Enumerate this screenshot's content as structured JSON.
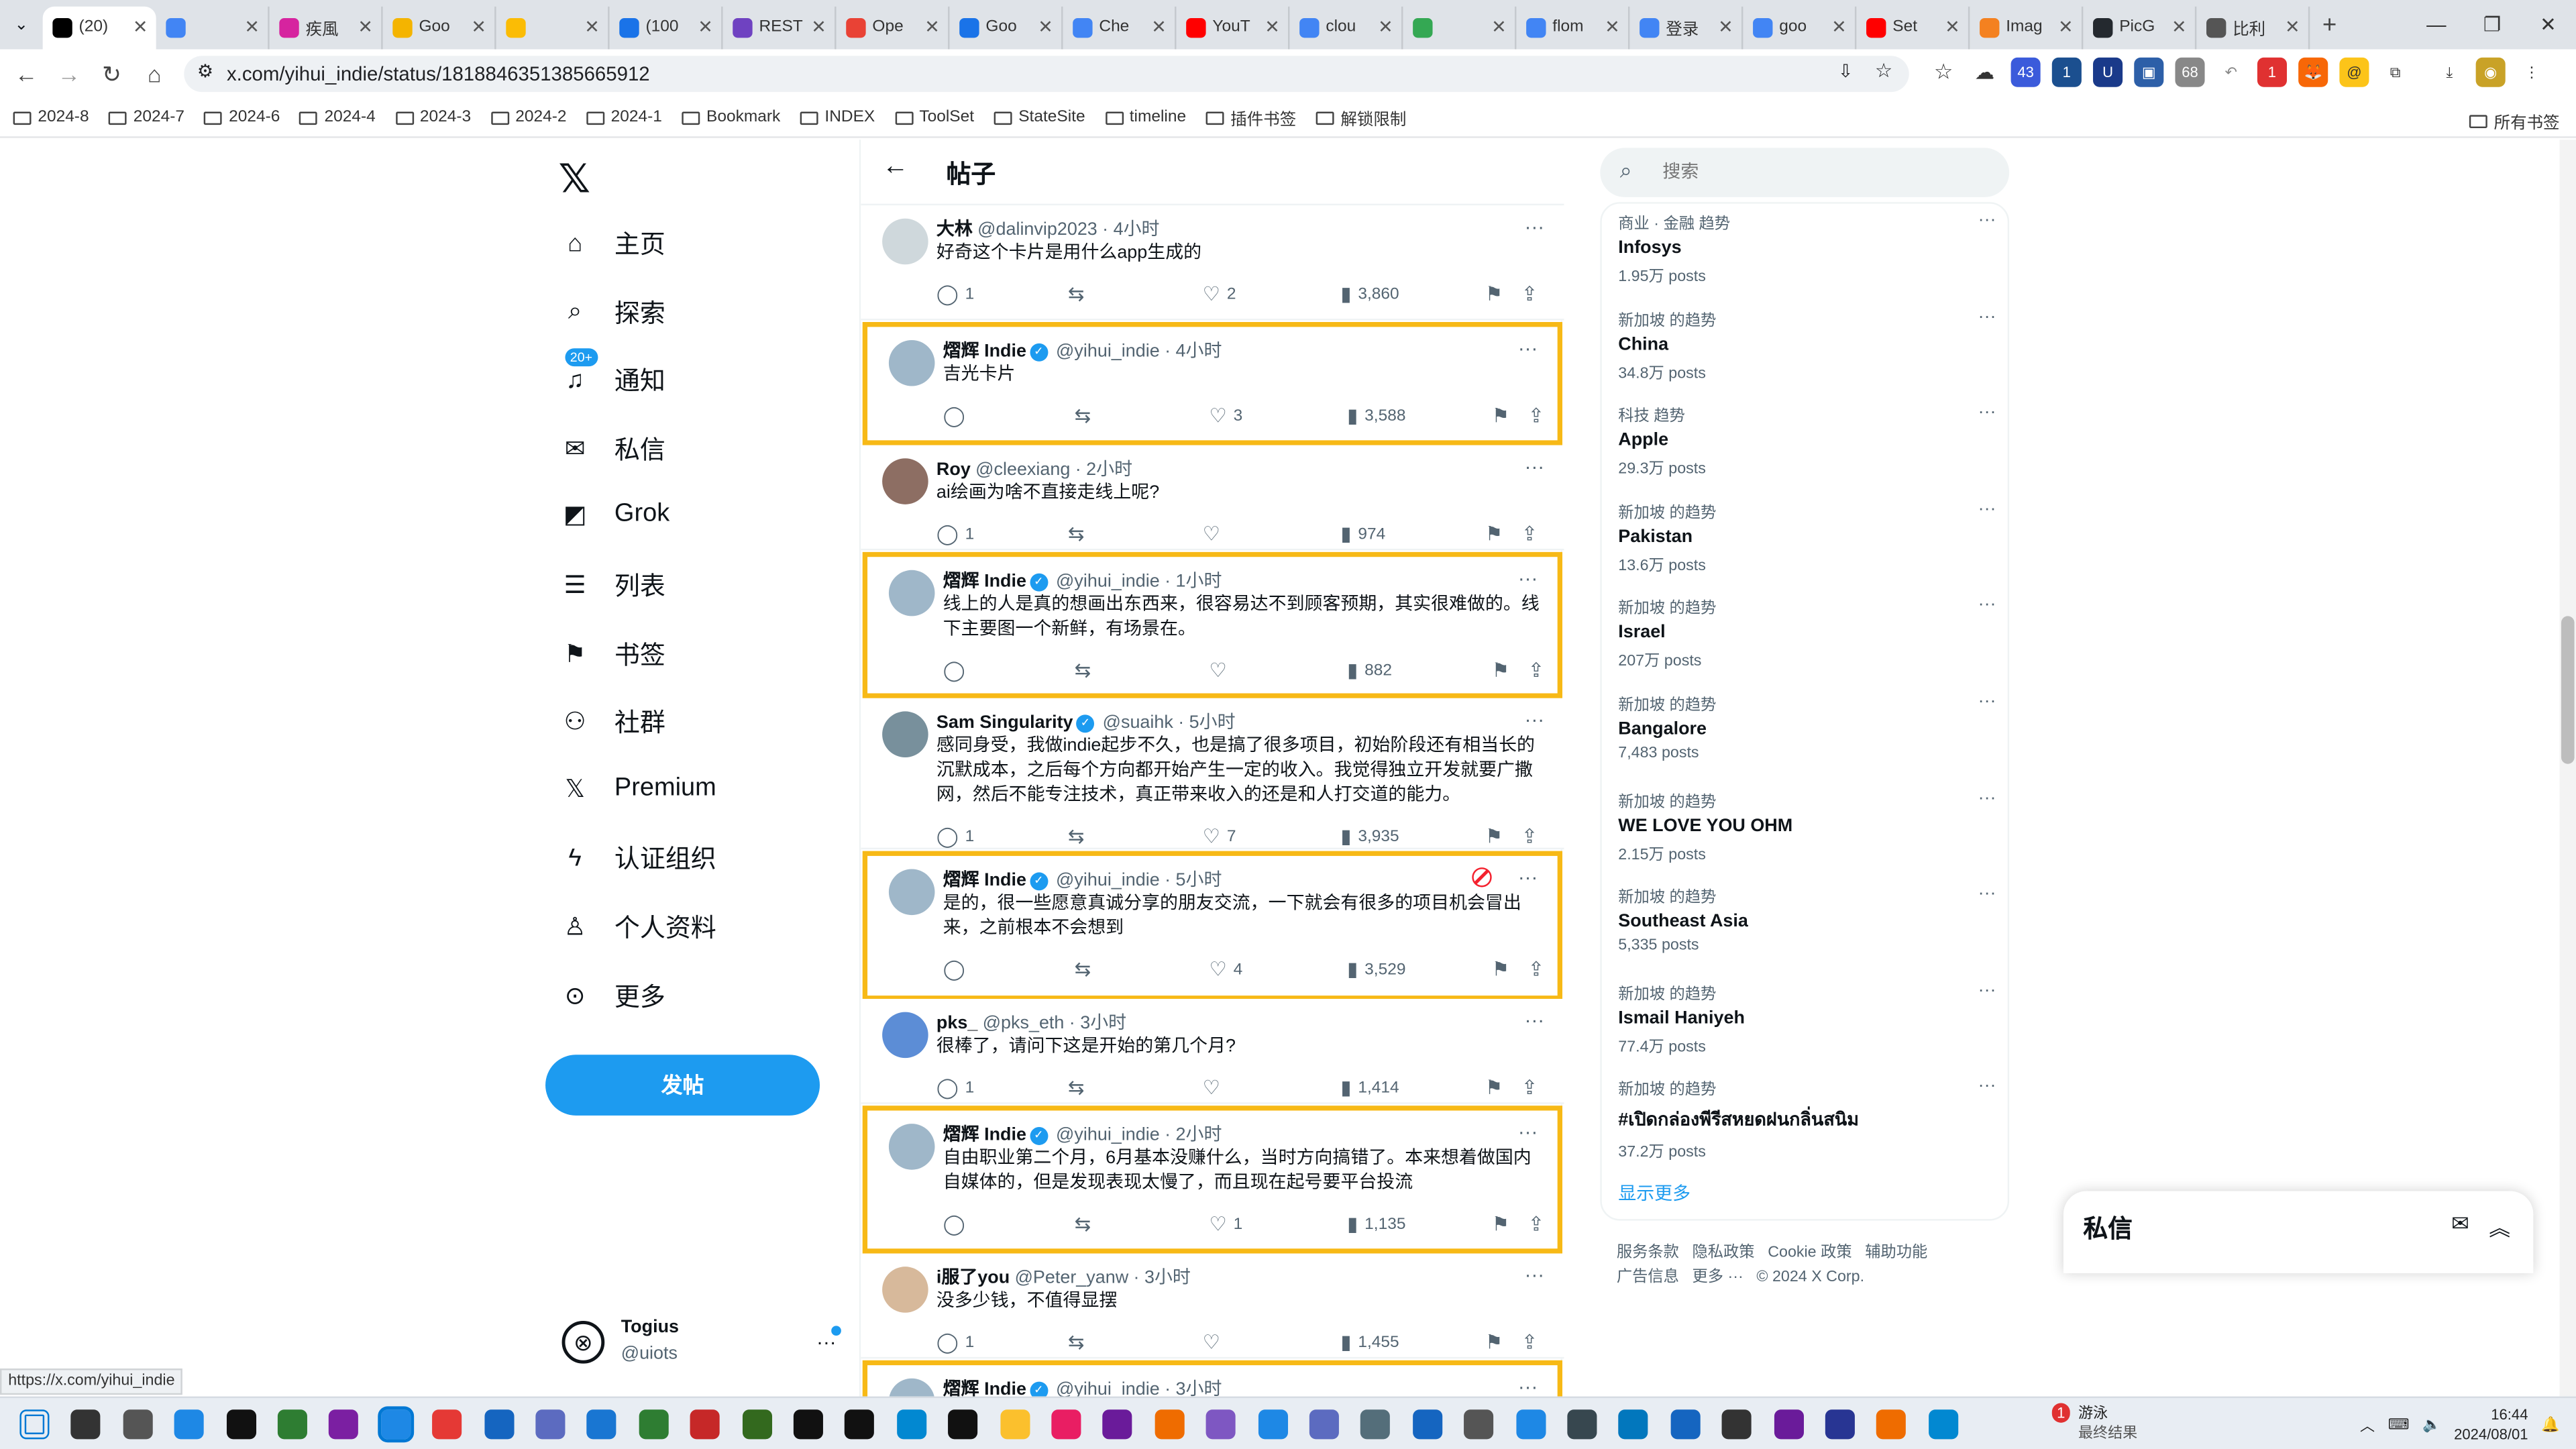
{
  "browser": {
    "tabs": [
      {
        "label": "(20)",
        "color": "#000000",
        "active": true
      },
      {
        "label": "",
        "color": "#4285f4"
      },
      {
        "label": "疾風",
        "color": "#d6249f"
      },
      {
        "label": "Goo",
        "color": "#f4b400"
      },
      {
        "label": "",
        "color": "#fbbc05"
      },
      {
        "label": "(100",
        "color": "#1a73e8"
      },
      {
        "label": "REST",
        "color": "#6f42c1"
      },
      {
        "label": "Ope",
        "color": "#e94235"
      },
      {
        "label": "Goo",
        "color": "#1a73e8"
      },
      {
        "label": "Che",
        "color": "#4285f4"
      },
      {
        "label": "YouT",
        "color": "#ff0000"
      },
      {
        "label": "clou",
        "color": "#4285f4"
      },
      {
        "label": "",
        "color": "#34a853"
      },
      {
        "label": "flom",
        "color": "#4285f4"
      },
      {
        "label": "登录",
        "color": "#4285f4"
      },
      {
        "label": "goo",
        "color": "#4285f4"
      },
      {
        "label": "Set",
        "color": "#ff0000"
      },
      {
        "label": "Imag",
        "color": "#f48120"
      },
      {
        "label": "PicG",
        "color": "#24292f"
      },
      {
        "label": "比利",
        "color": "#555555"
      }
    ],
    "url": "x.com/yihui_indie/status/1818846351385665912",
    "bookmarks": [
      "2024-8",
      "2024-7",
      "2024-6",
      "2024-4",
      "2024-3",
      "2024-2",
      "2024-1",
      "Bookmark",
      "INDEX",
      "ToolSet",
      "StateSite",
      "timeline",
      "插件书签",
      "解锁限制"
    ],
    "all_bookmarks": "所有书签",
    "ext_badges": {
      "a": "43",
      "b": "1",
      "c": "68",
      "d": "1"
    },
    "status_url": "https://x.com/yihui_indie"
  },
  "nav": {
    "items": [
      {
        "label": "主页",
        "icon": "home-icon"
      },
      {
        "label": "探索",
        "icon": "search-icon"
      },
      {
        "label": "通知",
        "icon": "bell-icon",
        "badge": "20+"
      },
      {
        "label": "私信",
        "icon": "mail-icon"
      },
      {
        "label": "Grok",
        "icon": "grok-icon"
      },
      {
        "label": "列表",
        "icon": "list-icon"
      },
      {
        "label": "书签",
        "icon": "bookmark-icon"
      },
      {
        "label": "社群",
        "icon": "people-icon"
      },
      {
        "label": "Premium",
        "icon": "x-icon"
      },
      {
        "label": "认证组织",
        "icon": "bolt-icon"
      },
      {
        "label": "个人资料",
        "icon": "person-icon"
      },
      {
        "label": "更多",
        "icon": "more-circle-icon"
      }
    ],
    "post_button": "发帖",
    "account": {
      "name": "Togius",
      "handle": "@uiots"
    }
  },
  "main": {
    "title": "帖子",
    "tweets": [
      {
        "name": "大林",
        "handle": "@dalinvip2023",
        "time": "· 4小时",
        "text": "好奇这个卡片是用什么app生成的",
        "replies": "1",
        "retweets": "",
        "likes": "2",
        "views": "3,860",
        "verified": false,
        "highlight": false
      },
      {
        "name": "熠辉 Indie",
        "handle": "@yihui_indie",
        "time": "· 4小时",
        "text": "吉光卡片",
        "replies": "",
        "retweets": "",
        "likes": "3",
        "views": "3,588",
        "verified": true,
        "highlight": true
      },
      {
        "name": "Roy",
        "handle": "@cleexiang",
        "time": "· 2小时",
        "text": "ai绘画为啥不直接走线上呢?",
        "replies": "1",
        "retweets": "",
        "likes": "",
        "views": "974",
        "verified": false,
        "highlight": false
      },
      {
        "name": "熠辉 Indie",
        "handle": "@yihui_indie",
        "time": "· 1小时",
        "text": "线上的人是真的想画出东西来，很容易达不到顾客预期，其实很难做的。线下主要图一个新鲜，有场景在。",
        "replies": "",
        "retweets": "",
        "likes": "",
        "views": "882",
        "verified": true,
        "highlight": true
      },
      {
        "name": "Sam Singularity",
        "handle": "@suaihk",
        "time": "· 5小时",
        "text": "感同身受，我做indie起步不久，也是搞了很多项目，初始阶段还有相当长的沉默成本，之后每个方向都开始产生一定的收入。我觉得独立开发就要广撒网，然后不能专注技术，真正带来收入的还是和人打交道的能力。",
        "replies": "1",
        "retweets": "",
        "likes": "7",
        "views": "3,935",
        "verified": true,
        "highlight": false
      },
      {
        "name": "熠辉 Indie",
        "handle": "@yihui_indie",
        "time": "· 5小时",
        "text": "是的，很一些愿意真诚分享的朋友交流，一下就会有很多的项目机会冒出来，之前根本不会想到",
        "replies": "",
        "retweets": "",
        "likes": "4",
        "views": "3,529",
        "verified": true,
        "highlight": true
      },
      {
        "name": "pks_",
        "handle": "@pks_eth",
        "time": "· 3小时",
        "text": "很棒了，请问下这是开始的第几个月?",
        "replies": "1",
        "retweets": "",
        "likes": "",
        "views": "1,414",
        "verified": false,
        "highlight": false
      },
      {
        "name": "熠辉 Indie",
        "handle": "@yihui_indie",
        "time": "· 2小时",
        "text": "自由职业第二个月，6月基本没赚什么，当时方向搞错了。本来想着做国内自媒体的，但是发现表现太慢了，而且现在起号要平台投流",
        "replies": "",
        "retweets": "",
        "likes": "1",
        "views": "1,135",
        "verified": true,
        "highlight": true
      },
      {
        "name": "i服了you",
        "handle": "@Peter_yanw",
        "time": "· 3小时",
        "text": "没多少钱，不值得显摆",
        "replies": "1",
        "retweets": "",
        "likes": "",
        "views": "1,455",
        "verified": false,
        "highlight": false
      },
      {
        "name": "熠辉 Indie",
        "handle": "@yihui_indie",
        "time": "· 3小时",
        "text": "",
        "replies": "",
        "retweets": "",
        "likes": "",
        "views": "",
        "verified": true,
        "highlight": true
      }
    ]
  },
  "right": {
    "search_placeholder": "搜索",
    "trends": [
      {
        "category": "商业 · 金融 趋势",
        "name": "Infosys",
        "posts": "1.95万 posts"
      },
      {
        "category": "新加坡 的趋势",
        "name": "China",
        "posts": "34.8万 posts"
      },
      {
        "category": "科技 趋势",
        "name": "Apple",
        "posts": "29.3万 posts"
      },
      {
        "category": "新加坡 的趋势",
        "name": "Pakistan",
        "posts": "13.6万 posts"
      },
      {
        "category": "新加坡 的趋势",
        "name": "Israel",
        "posts": "207万 posts"
      },
      {
        "category": "新加坡 的趋势",
        "name": "Bangalore",
        "posts": "7,483 posts"
      },
      {
        "category": "新加坡 的趋势",
        "name": "WE LOVE YOU OHM",
        "posts": "2.15万 posts"
      },
      {
        "category": "新加坡 的趋势",
        "name": "Southeast Asia",
        "posts": "5,335 posts"
      },
      {
        "category": "新加坡 的趋势",
        "name": "Ismail Haniyeh",
        "posts": "77.4万 posts"
      },
      {
        "category": "新加坡 的趋势",
        "name": "#เปิดกล่องพีรีสหยดฝนกลิ่นสนิม",
        "posts": "37.2万 posts"
      }
    ],
    "show_more": "显示更多",
    "footer": [
      "服务条款",
      "隐私政策",
      "Cookie 政策",
      "辅助功能",
      "广告信息",
      "更多 ···",
      "© 2024 X Corp."
    ]
  },
  "dm_dock": {
    "title": "私信"
  },
  "taskbar": {
    "weather_title": "游泳",
    "weather_sub": "最终结果",
    "weather_badge": "1",
    "time": "16:44",
    "date": "2024/08/01"
  }
}
